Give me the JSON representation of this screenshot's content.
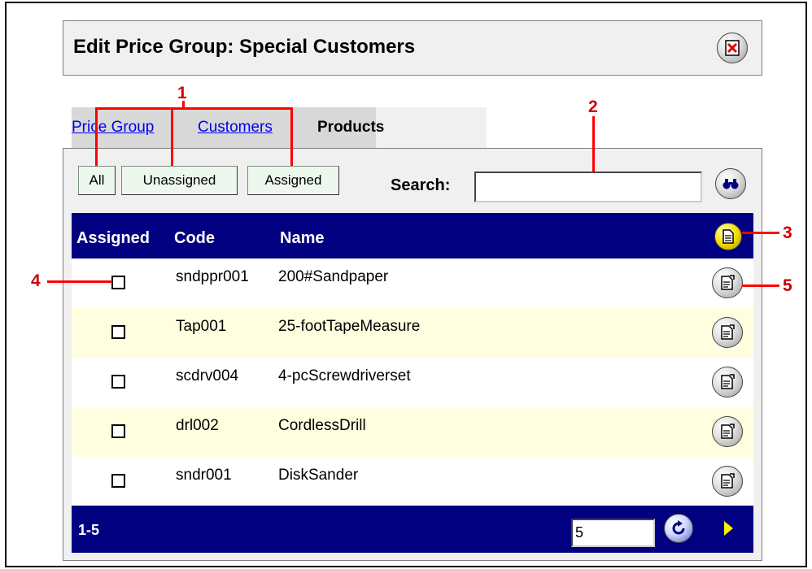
{
  "title": "Edit Price Group: Special Customers",
  "tabs": [
    {
      "label": "Price Group",
      "active": false
    },
    {
      "label": "Customers",
      "active": false
    },
    {
      "label": "Products",
      "active": true
    }
  ],
  "filters": {
    "all": "All",
    "unassigned": "Unassigned",
    "assigned": "Assigned"
  },
  "search": {
    "label": "Search:",
    "value": ""
  },
  "table": {
    "headers": {
      "assigned": "Assigned",
      "code": "Code",
      "name": "Name"
    },
    "rows": [
      {
        "code": "sndppr001",
        "name": "200#Sandpaper",
        "assigned": false
      },
      {
        "code": "Tap001",
        "name": "25-footTapeMeasure",
        "assigned": false
      },
      {
        "code": "scdrv004",
        "name": "4-pcScrewdriverset",
        "assigned": false
      },
      {
        "code": "drl002",
        "name": "CordlessDrill",
        "assigned": false
      },
      {
        "code": "sndr001",
        "name": "DiskSander",
        "assigned": false
      }
    ]
  },
  "footer": {
    "range": "1-5",
    "page_size": "5"
  },
  "annotations": [
    "1",
    "2",
    "3",
    "4",
    "5"
  ],
  "colors": {
    "header_bg": "#000080",
    "alt_row_bg": "#ffffe0",
    "annotation": "#ff0000",
    "link": "#0000ee"
  }
}
